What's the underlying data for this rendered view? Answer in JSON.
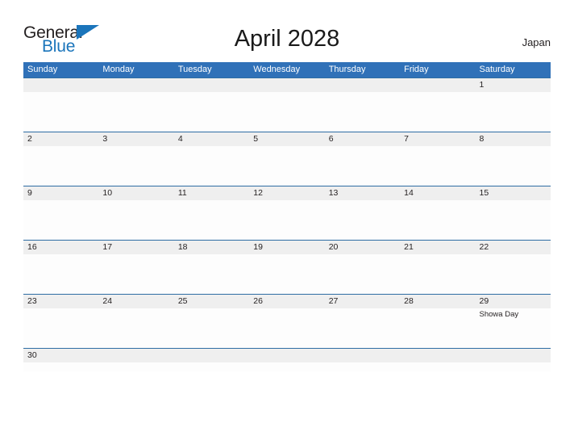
{
  "brand": {
    "name_part1": "General",
    "name_part2": "Blue",
    "flag_icon": "blue-flag-triangle",
    "color_dark": "#231f20",
    "color_blue": "#1b75bb"
  },
  "header": {
    "title": "April 2028",
    "locale": "Japan"
  },
  "theme": {
    "header_blue": "#3071b8",
    "row_divider_blue": "#2e6da4",
    "date_band_gray": "#efefef",
    "cell_white": "#fdfdfd",
    "text_dark": "#231f20"
  },
  "calendar": {
    "month": "April",
    "year": "2028",
    "weekday_headers": [
      "Sunday",
      "Monday",
      "Tuesday",
      "Wednesday",
      "Thursday",
      "Friday",
      "Saturday"
    ],
    "weeks": [
      {
        "days": [
          {
            "num": "",
            "events": []
          },
          {
            "num": "",
            "events": []
          },
          {
            "num": "",
            "events": []
          },
          {
            "num": "",
            "events": []
          },
          {
            "num": "",
            "events": []
          },
          {
            "num": "",
            "events": []
          },
          {
            "num": "1",
            "events": []
          }
        ]
      },
      {
        "days": [
          {
            "num": "2",
            "events": []
          },
          {
            "num": "3",
            "events": []
          },
          {
            "num": "4",
            "events": []
          },
          {
            "num": "5",
            "events": []
          },
          {
            "num": "6",
            "events": []
          },
          {
            "num": "7",
            "events": []
          },
          {
            "num": "8",
            "events": []
          }
        ]
      },
      {
        "days": [
          {
            "num": "9",
            "events": []
          },
          {
            "num": "10",
            "events": []
          },
          {
            "num": "11",
            "events": []
          },
          {
            "num": "12",
            "events": []
          },
          {
            "num": "13",
            "events": []
          },
          {
            "num": "14",
            "events": []
          },
          {
            "num": "15",
            "events": []
          }
        ]
      },
      {
        "days": [
          {
            "num": "16",
            "events": []
          },
          {
            "num": "17",
            "events": []
          },
          {
            "num": "18",
            "events": []
          },
          {
            "num": "19",
            "events": []
          },
          {
            "num": "20",
            "events": []
          },
          {
            "num": "21",
            "events": []
          },
          {
            "num": "22",
            "events": []
          }
        ]
      },
      {
        "days": [
          {
            "num": "23",
            "events": []
          },
          {
            "num": "24",
            "events": []
          },
          {
            "num": "25",
            "events": []
          },
          {
            "num": "26",
            "events": []
          },
          {
            "num": "27",
            "events": []
          },
          {
            "num": "28",
            "events": []
          },
          {
            "num": "29",
            "events": [
              "Showa Day"
            ]
          }
        ]
      },
      {
        "days": [
          {
            "num": "30",
            "events": []
          },
          {
            "num": "",
            "events": []
          },
          {
            "num": "",
            "events": []
          },
          {
            "num": "",
            "events": []
          },
          {
            "num": "",
            "events": []
          },
          {
            "num": "",
            "events": []
          },
          {
            "num": "",
            "events": []
          }
        ]
      }
    ]
  }
}
